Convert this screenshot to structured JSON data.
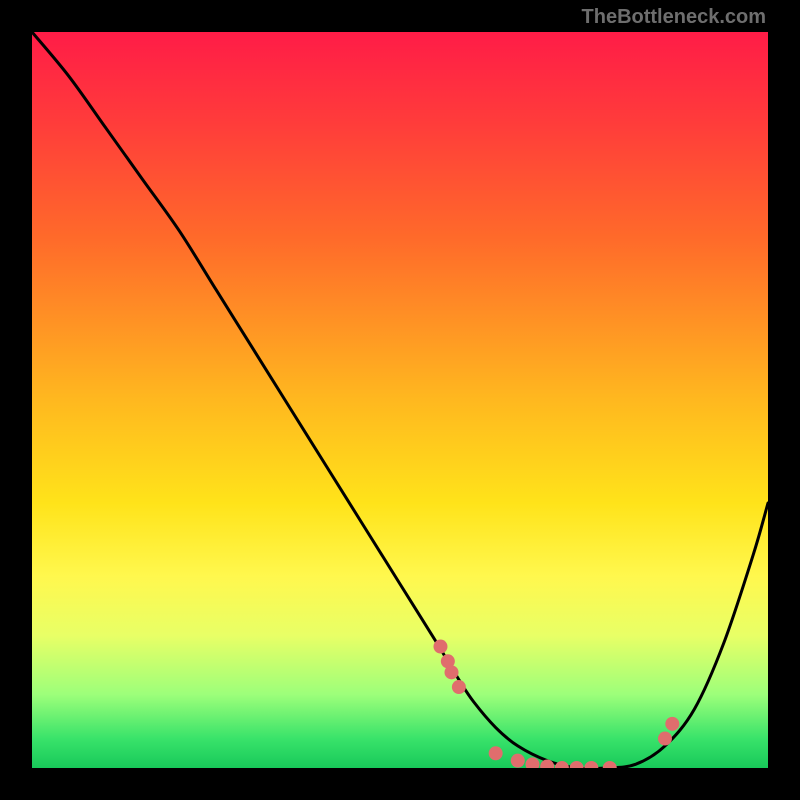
{
  "attribution": "TheBottleneck.com",
  "chart_data": {
    "type": "line",
    "title": "",
    "xlabel": "",
    "ylabel": "",
    "xlim": [
      0,
      100
    ],
    "ylim": [
      0,
      100
    ],
    "series": [
      {
        "name": "curve",
        "x": [
          0,
          5,
          10,
          15,
          20,
          25,
          30,
          35,
          40,
          45,
          50,
          55,
          58,
          60,
          63,
          66,
          70,
          74,
          78,
          82,
          86,
          90,
          94,
          98,
          100
        ],
        "y": [
          100,
          94,
          87,
          80,
          73,
          65,
          57,
          49,
          41,
          33,
          25,
          17,
          12,
          9,
          5.5,
          3,
          1,
          0,
          0,
          0.5,
          3,
          8,
          17,
          29,
          36
        ]
      }
    ],
    "markers": [
      {
        "x": 55.5,
        "y": 16.5
      },
      {
        "x": 56.5,
        "y": 14.5
      },
      {
        "x": 57.0,
        "y": 13.0
      },
      {
        "x": 58.0,
        "y": 11.0
      },
      {
        "x": 63.0,
        "y": 2.0
      },
      {
        "x": 66.0,
        "y": 1.0
      },
      {
        "x": 68.0,
        "y": 0.5
      },
      {
        "x": 70.0,
        "y": 0.2
      },
      {
        "x": 72.0,
        "y": 0.0
      },
      {
        "x": 74.0,
        "y": 0.0
      },
      {
        "x": 76.0,
        "y": 0.0
      },
      {
        "x": 78.5,
        "y": 0.0
      },
      {
        "x": 86.0,
        "y": 4.0
      },
      {
        "x": 87.0,
        "y": 6.0
      }
    ],
    "marker_color": "#e06d6d",
    "curve_color": "#000000"
  }
}
